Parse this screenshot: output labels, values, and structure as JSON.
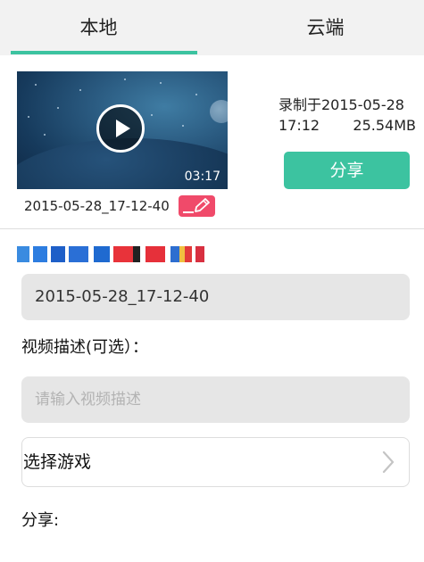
{
  "tabs": {
    "local": "本地",
    "cloud": "云端",
    "active": "local"
  },
  "video": {
    "duration": "03:17",
    "filename": "2015-05-28_17-12-40",
    "recorded_at": "录制于2015-05-28",
    "time": "17:12",
    "size": "25.54MB",
    "share_label": "分享"
  },
  "form": {
    "title_value": "2015-05-28_17-12-40",
    "description_label": "视频描述(可选）：",
    "description_placeholder": "请输入视频描述",
    "game_select_label": "选择游戏",
    "share_section_label": "分享:"
  },
  "colors": {
    "accent": "#3cc3a0",
    "edit": "#f04a6a",
    "field_bg": "#e6e6e6",
    "tab_bg": "#f2f2f2"
  },
  "icons": {
    "play": "play-icon",
    "edit": "pencil-icon",
    "chevron": "chevron-right-icon"
  }
}
